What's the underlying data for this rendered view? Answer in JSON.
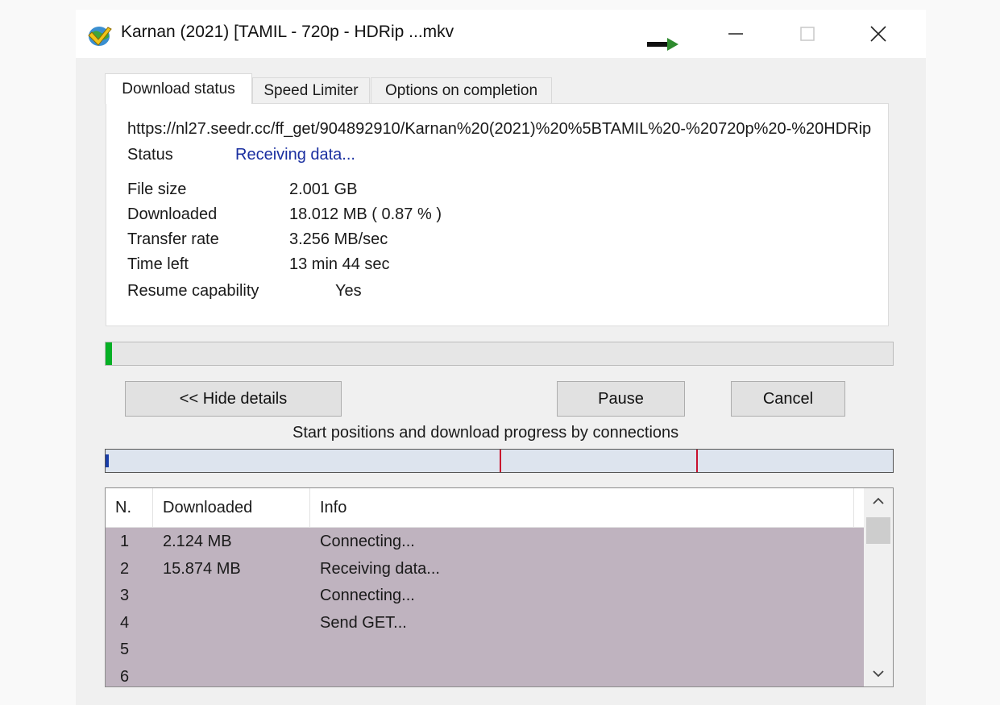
{
  "window": {
    "title": "Karnan (2021) [TAMIL - 720p - HDRip ...mkv"
  },
  "tabs": [
    {
      "label": "Download status",
      "active": true
    },
    {
      "label": "Speed Limiter",
      "active": false
    },
    {
      "label": "Options on completion",
      "active": false
    }
  ],
  "details": {
    "url": "https://nl27.seedr.cc/ff_get/904892910/Karnan%20(2021)%20%5BTAMIL%20-%20720p%20-%20HDRip",
    "status_label": "Status",
    "status_value": "Receiving data...",
    "file_size_label": "File size",
    "file_size_value": "2.001  GB",
    "downloaded_label": "Downloaded",
    "downloaded_value": "18.012  MB  ( 0.87 % )",
    "transfer_rate_label": "Transfer rate",
    "transfer_rate_value": "3.256  MB/sec",
    "time_left_label": "Time left",
    "time_left_value": "13 min 44 sec",
    "resume_label": "Resume capability",
    "resume_value": "Yes"
  },
  "progress": {
    "overall_fraction": 0.0087
  },
  "buttons": {
    "hide_details": "<< Hide details",
    "pause": "Pause",
    "cancel": "Cancel"
  },
  "connections": {
    "caption": "Start positions and download progress by connections",
    "start_fractions": [
      0.0,
      0.5,
      0.75
    ],
    "colors": {
      "progress": "#1a3ea8",
      "marker": "#c8102e",
      "bar_bg": "#dde4ee"
    }
  },
  "table": {
    "headers": [
      "N.",
      "Downloaded",
      "Info"
    ],
    "rows": [
      {
        "n": "1",
        "downloaded": "2.124  MB",
        "info": "Connecting..."
      },
      {
        "n": "2",
        "downloaded": "15.874  MB",
        "info": "Receiving data..."
      },
      {
        "n": "3",
        "downloaded": "",
        "info": "Connecting..."
      },
      {
        "n": "4",
        "downloaded": "",
        "info": "Send GET..."
      },
      {
        "n": "5",
        "downloaded": "",
        "info": ""
      },
      {
        "n": "6",
        "downloaded": "",
        "info": ""
      }
    ]
  },
  "icons": {
    "app": "globe-download-icon",
    "arrow": "green-arrow-icon"
  }
}
